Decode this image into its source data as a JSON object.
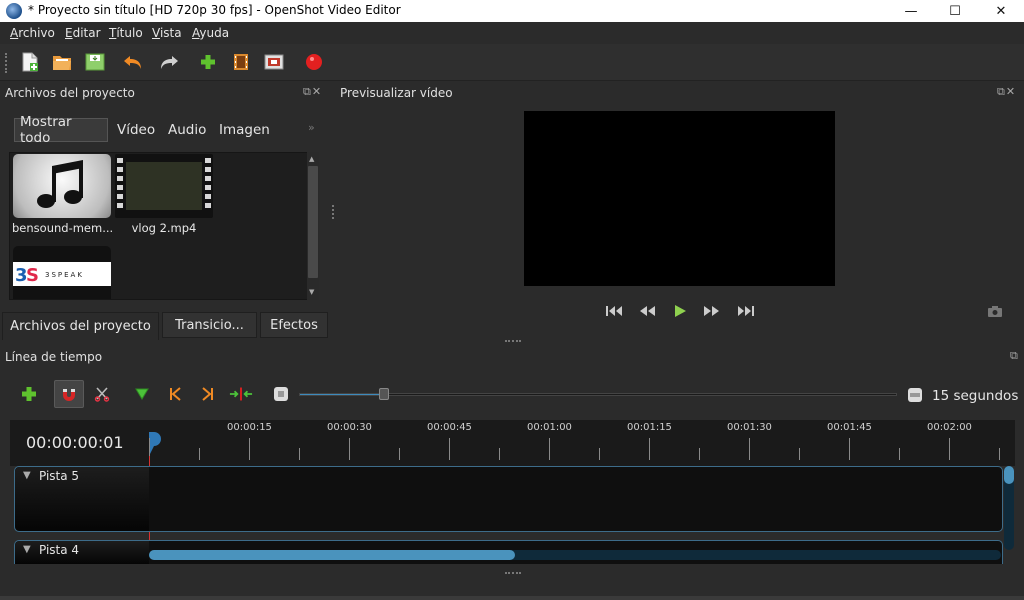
{
  "window": {
    "title": "* Proyecto sin título [HD 720p 30 fps] - OpenShot Video Editor",
    "min": "—",
    "max": "☐",
    "close": "✕"
  },
  "menu": [
    {
      "first": "A",
      "rest": "rchivo"
    },
    {
      "first": "E",
      "rest": "ditar"
    },
    {
      "first": "T",
      "rest": "ítulo"
    },
    {
      "first": "V",
      "rest": "ista"
    },
    {
      "first": "A",
      "rest": "yuda"
    }
  ],
  "toolbar": {
    "icons": [
      "new-project-icon",
      "open-project-icon",
      "save-project-icon",
      "undo-icon",
      "redo-icon",
      "import-files-icon",
      "choose-profile-icon",
      "fullscreen-icon",
      "export-video-icon"
    ]
  },
  "project_files": {
    "title": "Archivos del proyecto",
    "filters": [
      "Mostrar todo",
      "Vídeo",
      "Audio",
      "Imagen"
    ],
    "more": "»",
    "items": [
      {
        "label": "bensound-mem..."
      },
      {
        "label": "vlog 2.mp4"
      },
      {
        "label": "3SPEAK"
      }
    ],
    "tabs": [
      "Archivos del proyecto",
      "Transicio...",
      "Efectos"
    ]
  },
  "preview": {
    "title": "Previsualizar vídeo"
  },
  "timeline": {
    "title": "Línea de tiempo",
    "zoom_label": "15 segundos",
    "zoom_level_fraction": 0.14,
    "current_time": "00:00:00:01",
    "ticks": [
      "00:00:15",
      "00:00:30",
      "00:00:45",
      "00:01:00",
      "00:01:15",
      "00:01:30",
      "00:01:45",
      "00:02:00"
    ],
    "tracks": [
      "Pista 5",
      "Pista 4"
    ],
    "hscroll_fraction": 0.43
  },
  "colors": {
    "accent": "#3d8bbd",
    "record": "#e32020",
    "add": "#5fc22e",
    "orange": "#f08a24"
  }
}
